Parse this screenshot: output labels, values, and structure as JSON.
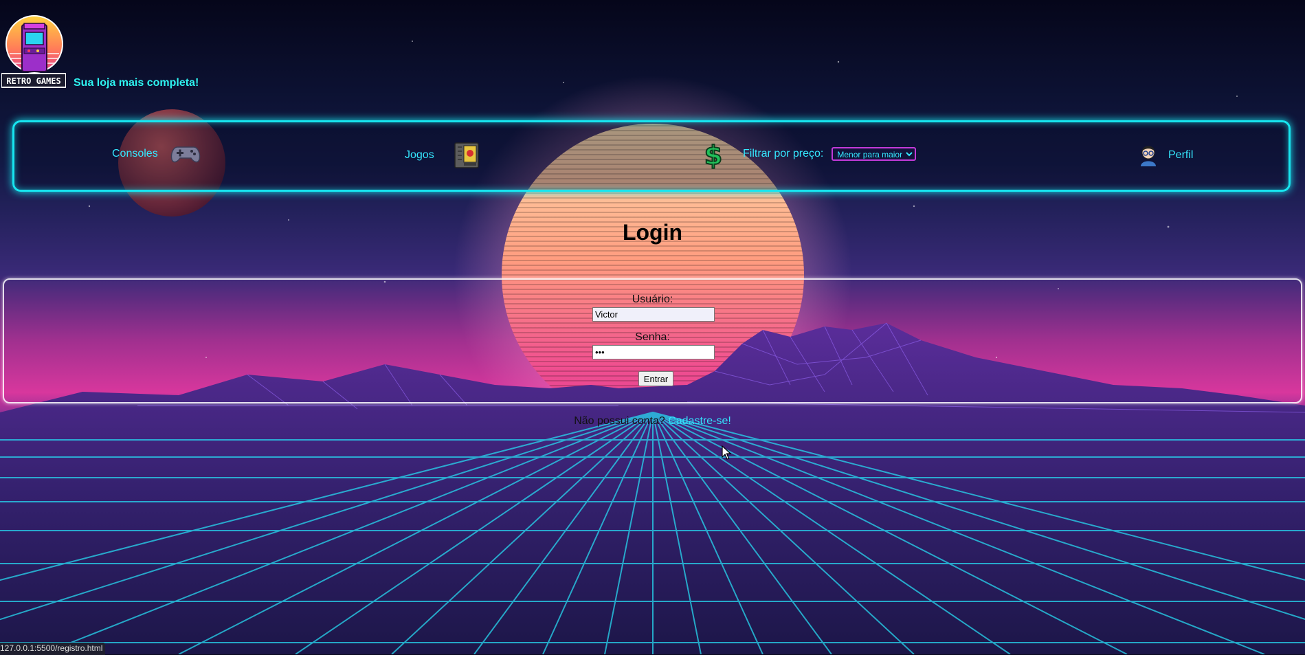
{
  "header": {
    "logo_text": "RETRO GAMES",
    "tagline": "Sua loja mais completa!"
  },
  "nav": {
    "consoles_label": "Consoles",
    "consoles_icon": "gamepad-icon",
    "jogos_label": "Jogos",
    "jogos_icon": "game-cartridge-icon",
    "price_icon": "dollar-sign-icon",
    "price_filter_label": "Filtrar por preço:",
    "price_filter_selected": "Menor para maior",
    "perfil_label": "Perfil",
    "perfil_icon": "user-avatar-icon"
  },
  "login": {
    "title": "Login",
    "username_label": "Usuário:",
    "username_value": "Victor",
    "password_label": "Senha:",
    "password_value": "•••",
    "submit_label": "Entrar"
  },
  "register": {
    "prompt": "Não possui conta?",
    "link_text": "Cadastre-se!"
  },
  "status_bar": {
    "url": "127.0.0.1:5500/registro.html"
  },
  "colors": {
    "neon_cyan": "#17e6f0",
    "neon_pink": "#c33ad9",
    "link": "#34e6ff"
  }
}
